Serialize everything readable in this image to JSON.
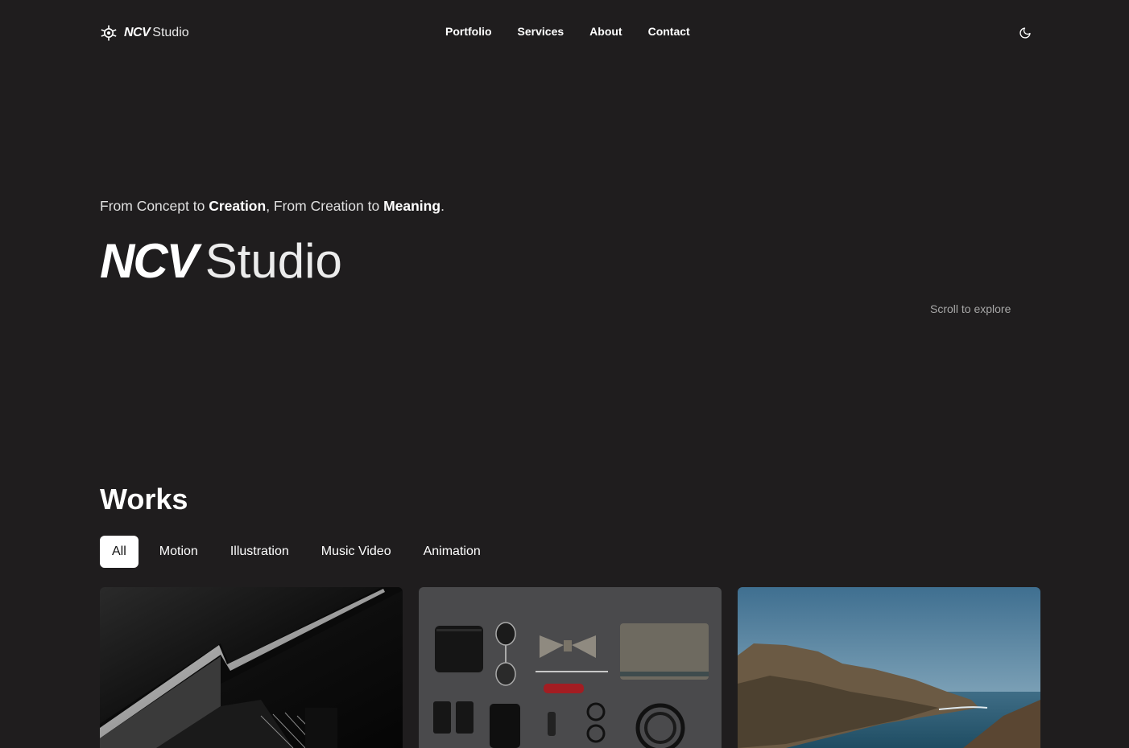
{
  "header": {
    "logo": {
      "ncv": "NCV",
      "studio": "Studio"
    },
    "nav": [
      "Portfolio",
      "Services",
      "About",
      "Contact"
    ],
    "theme_icon": "moon-icon"
  },
  "hero": {
    "tagline": {
      "part1": "From Concept to ",
      "bold1": "Creation",
      "part2": ", From Creation to ",
      "bold2": "Meaning",
      "part3": "."
    },
    "title": {
      "ncv": "NCV",
      "studio": "Studio"
    },
    "scroll_hint": "Scroll to explore"
  },
  "works": {
    "title": "Works",
    "filters": [
      "All",
      "Motion",
      "Illustration",
      "Music Video",
      "Animation"
    ],
    "active_filter": "All",
    "cards": [
      {
        "subject": "black-and-white architecture"
      },
      {
        "subject": "flat lay of accessories"
      },
      {
        "subject": "coastal cliffs and sea"
      }
    ]
  },
  "colors": {
    "background": "#1f1d1e",
    "text": "#ffffff",
    "muted": "#a7a7a7",
    "active_filter_bg": "#ffffff"
  }
}
